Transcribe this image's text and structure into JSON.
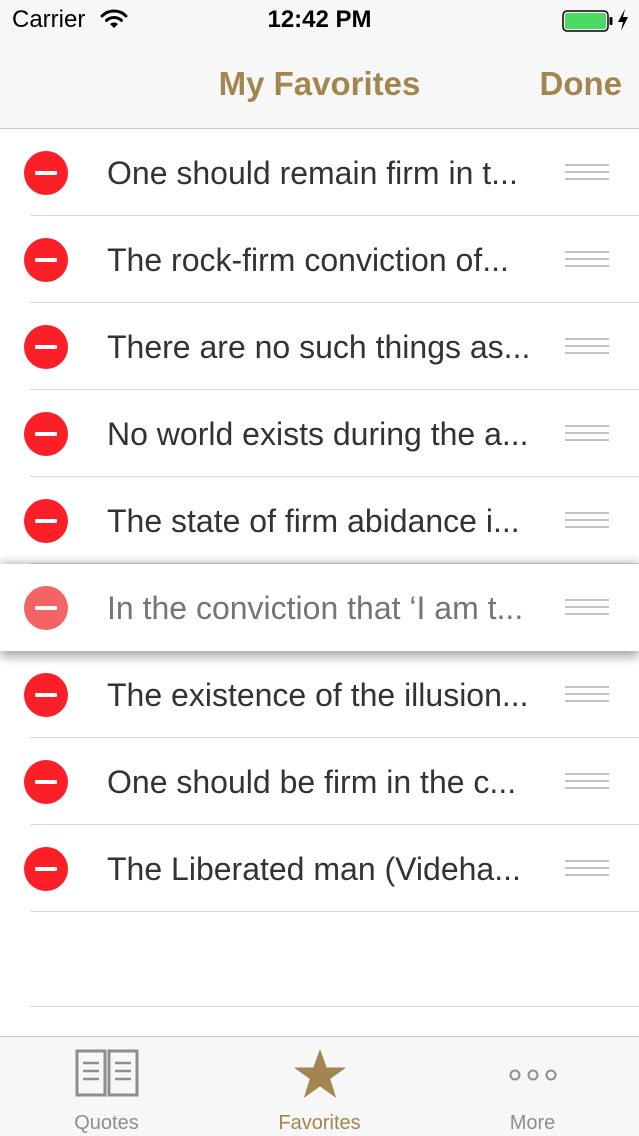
{
  "status_bar": {
    "carrier": "Carrier",
    "time": "12:42 PM",
    "battery_color": "#4cd964"
  },
  "nav": {
    "title": "My Favorites",
    "done_label": "Done"
  },
  "accent_color": "#a3864f",
  "delete_color": "#fb1f28",
  "favorites": [
    {
      "text": "One should remain firm in t..."
    },
    {
      "text": "The rock-firm conviction of..."
    },
    {
      "text": "There are no such things as..."
    },
    {
      "text": "No world exists during the a..."
    },
    {
      "text": "The state of firm abidance i..."
    },
    {
      "text": "In the conviction that ‘I am t..."
    },
    {
      "text": "The existence of the illusion..."
    },
    {
      "text": "One should be firm in the c..."
    },
    {
      "text": "The Liberated man (Videha..."
    }
  ],
  "tabs": [
    {
      "label": "Quotes",
      "icon": "book-icon",
      "selected": false
    },
    {
      "label": "Favorites",
      "icon": "star-icon",
      "selected": true
    },
    {
      "label": "More",
      "icon": "more-icon",
      "selected": false
    }
  ]
}
